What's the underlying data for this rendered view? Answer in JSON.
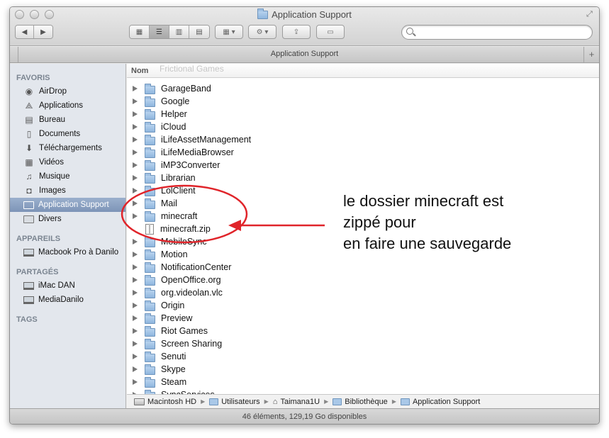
{
  "window": {
    "title": "Application Support",
    "tab_label": "Application Support",
    "status": "46 éléments, 129,19 Go disponibles"
  },
  "toolbar": {
    "nav_back": "◀",
    "nav_forward": "▶",
    "search_placeholder": ""
  },
  "sidebar": {
    "favorites_header": "FAVORIS",
    "favorites": [
      {
        "label": "AirDrop",
        "icon": "airdrop-icon"
      },
      {
        "label": "Applications",
        "icon": "applications-icon"
      },
      {
        "label": "Bureau",
        "icon": "desktop-icon"
      },
      {
        "label": "Documents",
        "icon": "documents-icon"
      },
      {
        "label": "Téléchargements",
        "icon": "downloads-icon"
      },
      {
        "label": "Vidéos",
        "icon": "movies-icon"
      },
      {
        "label": "Musique",
        "icon": "music-icon"
      },
      {
        "label": "Images",
        "icon": "camera-icon"
      },
      {
        "label": "Application Support",
        "icon": "folder-icon",
        "selected": true
      },
      {
        "label": "Divers",
        "icon": "folder-icon"
      }
    ],
    "devices_header": "APPAREILS",
    "devices": [
      {
        "label": "Macbook Pro à Danilo",
        "icon": "laptop-icon"
      }
    ],
    "shared_header": "PARTAGÉS",
    "shared": [
      {
        "label": "iMac DAN",
        "icon": "monitor-icon"
      },
      {
        "label": "MediaDanilo",
        "icon": "monitor-icon"
      }
    ],
    "tags_header": "TAGS"
  },
  "list": {
    "column_name": "Nom",
    "ghost_item": "Frictional Games",
    "items": [
      {
        "name": "GarageBand",
        "kind": "folder"
      },
      {
        "name": "Google",
        "kind": "folder"
      },
      {
        "name": "Helper",
        "kind": "folder"
      },
      {
        "name": "iCloud",
        "kind": "folder"
      },
      {
        "name": "iLifeAssetManagement",
        "kind": "folder"
      },
      {
        "name": "iLifeMediaBrowser",
        "kind": "folder"
      },
      {
        "name": "iMP3Converter",
        "kind": "folder"
      },
      {
        "name": "Librarian",
        "kind": "folder"
      },
      {
        "name": "LolClient",
        "kind": "folder"
      },
      {
        "name": "Mail",
        "kind": "folder"
      },
      {
        "name": "minecraft",
        "kind": "folder"
      },
      {
        "name": "minecraft.zip",
        "kind": "file"
      },
      {
        "name": "MobileSync",
        "kind": "folder"
      },
      {
        "name": "Motion",
        "kind": "folder"
      },
      {
        "name": "NotificationCenter",
        "kind": "folder"
      },
      {
        "name": "OpenOffice.org",
        "kind": "folder"
      },
      {
        "name": "org.videolan.vlc",
        "kind": "folder"
      },
      {
        "name": "Origin",
        "kind": "folder"
      },
      {
        "name": "Preview",
        "kind": "folder"
      },
      {
        "name": "Riot Games",
        "kind": "folder"
      },
      {
        "name": "Screen Sharing",
        "kind": "folder"
      },
      {
        "name": "Senuti",
        "kind": "folder"
      },
      {
        "name": "Skype",
        "kind": "folder"
      },
      {
        "name": "Steam",
        "kind": "folder"
      },
      {
        "name": "SyncServices",
        "kind": "folder"
      }
    ]
  },
  "pathbar": [
    "Macintosh HD",
    "Utilisateurs",
    "Taimana1U",
    "Bibliothèque",
    "Application Support"
  ],
  "annotation": {
    "line1": "le dossier minecraft est",
    "line2": "zippé pour",
    "line3": "en faire une sauvegarde",
    "color": "#e0242a"
  }
}
